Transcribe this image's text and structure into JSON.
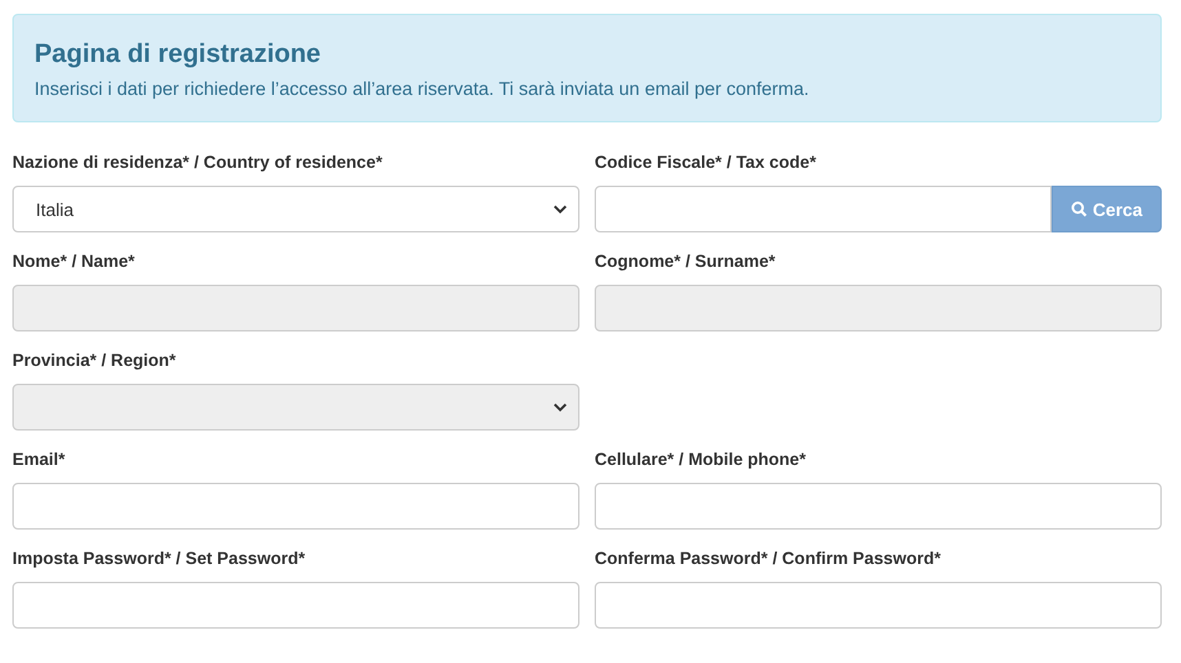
{
  "alert": {
    "title": "Pagina di registrazione",
    "text": "Inserisci i dati per richiedere l’accesso all’area riservata. Ti sarà inviata un email per conferma."
  },
  "rows": [
    {
      "fields": [
        {
          "kind": "select",
          "label": "Nazione di residenza* / Country of residence*",
          "value": "Italia",
          "disabled": false
        },
        {
          "kind": "search",
          "label": "Codice Fiscale* / Tax code*",
          "button": "Cerca",
          "disabled": false
        }
      ]
    },
    {
      "fields": [
        {
          "kind": "input",
          "label": "Nome* / Name*",
          "disabled": true
        },
        {
          "kind": "input",
          "label": "Cognome* / Surname*",
          "disabled": true
        }
      ]
    },
    {
      "fields": [
        {
          "kind": "select",
          "label": "Provincia* / Region*",
          "disabled": true
        }
      ]
    },
    {
      "fields": [
        {
          "kind": "input",
          "label": "Email*",
          "disabled": false
        },
        {
          "kind": "input",
          "label": "Cellulare* / Mobile phone*",
          "disabled": false
        }
      ]
    },
    {
      "fields": [
        {
          "kind": "input",
          "label": "Imposta Password* / Set Password*",
          "disabled": false
        },
        {
          "kind": "input",
          "label": "Conferma Password* / Confirm Password*",
          "disabled": false
        }
      ]
    }
  ]
}
